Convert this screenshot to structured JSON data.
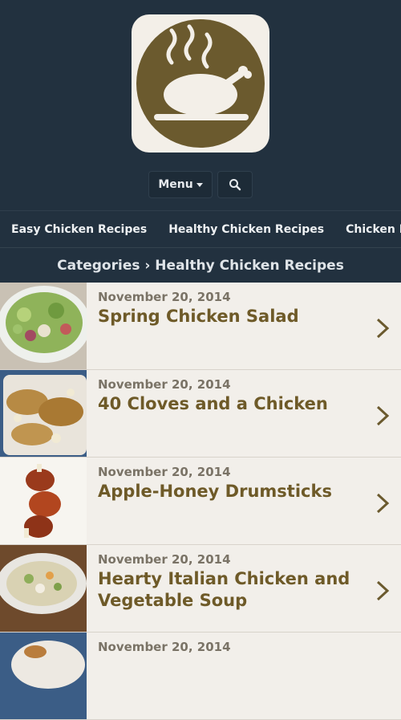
{
  "header": {
    "logo": "steaming-roast-chicken-logo",
    "menu_label": "Menu",
    "search_icon": "search-icon"
  },
  "nav": {
    "items": [
      "Easy Chicken Recipes",
      "Healthy Chicken Recipes",
      "Chicken Parmesan"
    ]
  },
  "breadcrumb": {
    "text": "Categories › Healthy Chicken Recipes"
  },
  "posts": [
    {
      "date": "November 20, 2014",
      "title": "Spring Chicken Salad"
    },
    {
      "date": "November 20, 2014",
      "title": "40 Cloves and a Chicken"
    },
    {
      "date": "November 20, 2014",
      "title": "Apple-Honey Drumsticks"
    },
    {
      "date": "November 20, 2014",
      "title": "Hearty Italian Chicken and Vegetable Soup"
    },
    {
      "date": "November 20, 2014",
      "title": ""
    }
  ],
  "colors": {
    "header_bg": "#22313f",
    "logo_brown": "#6b5a2e",
    "title_brown": "#6e5a28",
    "list_bg": "#f2efea"
  }
}
